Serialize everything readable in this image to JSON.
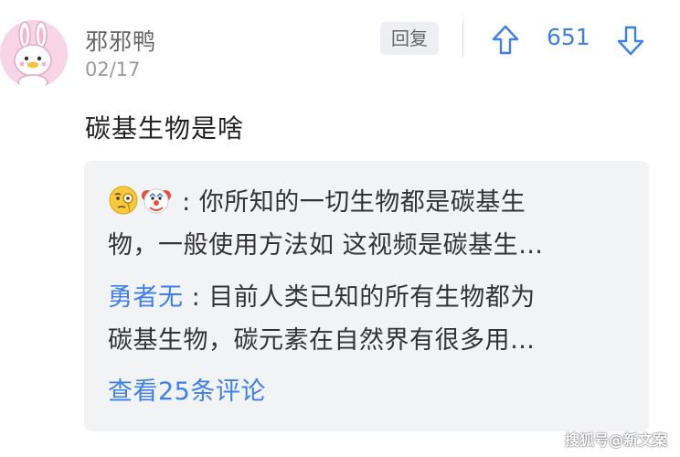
{
  "comment": {
    "username": "邪邪鸭",
    "date": "02/17",
    "text": "碳基生物是啥",
    "reply_button_label": "回复",
    "vote_count": "651",
    "upvote_icon": "arrow-up-icon",
    "downvote_icon": "arrow-down-icon",
    "avatar_icon": "bunny-avatar"
  },
  "replies": [
    {
      "author_icons": [
        "face-with-monocle-emoji",
        "clown-face-emoji"
      ],
      "author": "",
      "separator": " : ",
      "line1": "你所知的一切生物都是碳基生",
      "line2": "物，一般使用方法如 这视频是碳基生…"
    },
    {
      "author": "勇者无",
      "separator": " : ",
      "line1": "目前人类已知的所有生物都为",
      "line2": "碳基生物，碳元素在自然界有很多用…"
    }
  ],
  "view_more_label": "查看25条评论",
  "watermark": "搜狐号@新文案",
  "colors": {
    "accent": "#3d7ff0",
    "box_bg": "#f2f3f5",
    "avatar_bg": "#f7d4e6"
  }
}
